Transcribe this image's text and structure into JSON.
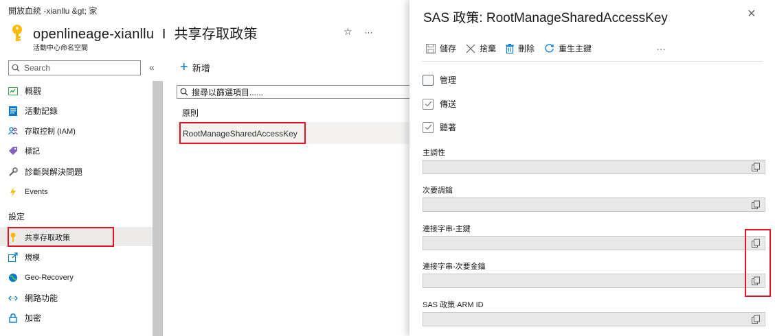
{
  "breadcrumb": "開放血統 -xianllu &gt; 家",
  "header": {
    "title": "openlineage-xianllu",
    "separator": "I",
    "section": "共享存取政策",
    "subtitle": "活動中心命名空間",
    "actions": [
      "☆",
      "···"
    ]
  },
  "sidebar": {
    "search_placeholder": "Search",
    "collapse": "«",
    "items": [
      {
        "label": "概觀",
        "icon": "overview-icon"
      },
      {
        "label": "活動記錄",
        "icon": "activity-log-icon"
      },
      {
        "label": "存取控制 (IAM)",
        "icon": "iam-icon"
      },
      {
        "label": "標記",
        "icon": "tag-icon"
      },
      {
        "label": "診斷與解決問題",
        "icon": "wrench-icon"
      },
      {
        "label": "Events",
        "icon": "lightning-icon"
      }
    ],
    "section_label": "設定",
    "settings_items": [
      {
        "label": "共享存取政策",
        "icon": "key-icon"
      },
      {
        "label": "規模",
        "icon": "scale-icon"
      },
      {
        "label": "Geo-Recovery",
        "icon": "globe-icon"
      },
      {
        "label": "網路功能",
        "icon": "network-icon"
      },
      {
        "label": "加密",
        "icon": "lock-icon"
      }
    ]
  },
  "middle": {
    "add_label": "新增",
    "filter_placeholder": "搜尋以篩選項目......",
    "column_header": "原則",
    "rows": [
      "RootManageSharedAccessKey"
    ]
  },
  "panel": {
    "title": "SAS 政策: RootManageSharedAccessKey",
    "close": "×",
    "toolbar": {
      "save": "儲存",
      "discard": "捨棄",
      "delete": "刪除",
      "regenerate": "重生主鍵",
      "more": "···"
    },
    "checkboxes": [
      {
        "label": "管理",
        "checked": false
      },
      {
        "label": "傳送",
        "checked": true
      },
      {
        "label": "聽著",
        "checked": true
      }
    ],
    "fields": [
      {
        "label": "主調性"
      },
      {
        "label": "次要調鑰"
      },
      {
        "label": "連接字串-主鍵"
      },
      {
        "label": "連接字串-次要金鑰"
      },
      {
        "label": "SAS 政策 ARM ID"
      }
    ]
  },
  "colors": {
    "accent": "#0078d4",
    "highlight_border": "#e81123",
    "key_yellow": "#ffb900"
  }
}
